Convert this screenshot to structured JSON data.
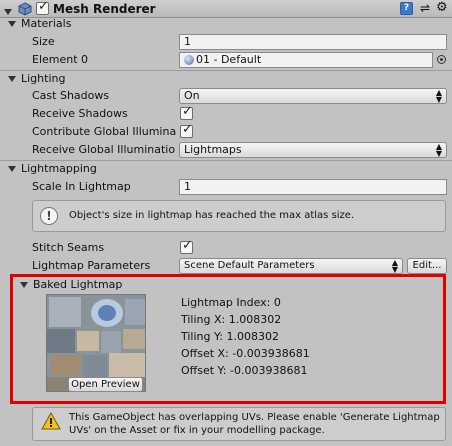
{
  "header": {
    "title": "Mesh Renderer",
    "enabled": true
  },
  "materials": {
    "label": "Materials",
    "size_label": "Size",
    "size_value": "1",
    "element_label": "Element 0",
    "element_value": "01 - Default"
  },
  "lighting": {
    "label": "Lighting",
    "cast_shadows_label": "Cast Shadows",
    "cast_shadows_value": "On",
    "receive_shadows_label": "Receive Shadows",
    "contribute_gi_label": "Contribute Global Illumina",
    "receive_gi_label": "Receive Global Illuminatio",
    "receive_gi_value": "Lightmaps"
  },
  "lightmapping": {
    "label": "Lightmapping",
    "scale_label": "Scale In Lightmap",
    "scale_value": "1",
    "info_message": "Object's size in lightmap has reached the max atlas size.",
    "stitch_seams_label": "Stitch Seams",
    "params_label": "Lightmap Parameters",
    "params_value": "Scene Default Parameters",
    "edit_button": "Edit..."
  },
  "baked": {
    "label": "Baked Lightmap",
    "open_preview": "Open Preview",
    "lightmap_index": "Lightmap Index: 0",
    "tiling_x": "Tiling X: 1.008302",
    "tiling_y": "Tiling Y: 1.008302",
    "offset_x": "Offset X: -0.003938681",
    "offset_y": "Offset Y: -0.003938681"
  },
  "warning": {
    "message": "This GameObject has overlapping UVs. Please enable 'Generate Lightmap UVs' on the Asset or fix in your modelling package."
  },
  "colors": {
    "highlight_box": "#e00000",
    "background": "#c2c2c2"
  }
}
